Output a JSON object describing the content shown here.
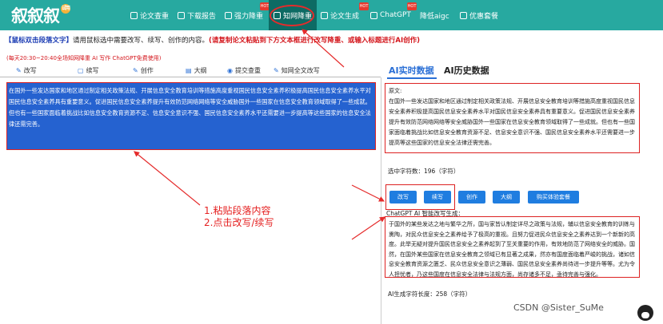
{
  "logo": {
    "text": "叙叙叙",
    "badge": "试用"
  },
  "nav": {
    "items": [
      "论文查重",
      "下载报告",
      "强力降重",
      "知网降重",
      "论文生成",
      "ChatGPT",
      "降低aigc",
      "优惠套餐"
    ],
    "hot_badges": [
      "HOT",
      "HOT",
      "HOT"
    ]
  },
  "instruction": {
    "prefix": "【鼠标双击段落文字】",
    "middle": "请用鼠标选中需要改写、续写、创作的内容。",
    "suffix": "(请复制论文粘贴到下方文本框进行改写降重、或输入标题进行AI创作)"
  },
  "notice": "(每天20:30~20:40全场知网降重 AI 写作 ChatGPT免费使用)",
  "toolbar": {
    "items": [
      "改写",
      "续写",
      "创作",
      "大纲",
      "提交查重",
      "知网全文改写"
    ],
    "icons": [
      "✎",
      "▢",
      "✎",
      "▤",
      "◉",
      "✎"
    ]
  },
  "selected_text": "在国外一些发达国家和地区通过制定相关政策法规、开展信息安全教育培训等措施高度重视国民信息安全素养积极提高国民信息安全素养水平对国民信息安全素养具有重要意义。促进国民信息安全素养提升有效防范网络网络等安全威胁国外一些国家在信息安全教育领域取得了一些成就。但也有一些国家面临着挑战比如信息安全教育资源不足、信息安全意识不强、国民信息安全素养水平还需要进一步提高等这些国家的信息安全法律还需完善。",
  "annotation": {
    "line1": "1.粘贴段落内容",
    "line2": "2.点击改写/续写"
  },
  "tabs": {
    "realtime": "AI实时数据",
    "history": "AI历史数据"
  },
  "original": {
    "label": "原文:",
    "text": "在国外一些发达国家和地区通过制定相关政策法规、开展信息安全教育培训等措施高度重视国民信息安全素养积极提高国民信息安全素养水平对国民信息安全素养具有重要意义。促进国民信息安全素养提升有效防范网络网络等安全威胁国外一些国家在信息安全教育领域取得了一些成就。但也有一些国家面临着挑战比如信息安全教育资源不足、信息安全意识不强、国民信息安全素养水平还需要进一步提高等这些国家的信息安全法律还需完善。"
  },
  "word_count": "选中字符数：196（字符）",
  "buttons": [
    "改写",
    "续写",
    "创作",
    "大纲",
    "购买体验套餐"
  ],
  "generated": {
    "label": "ChatGPT AI 智能改写生成：",
    "text": "于国外的某些发达之地与繁华之所，国与家皆认制定详尽之政策与法规，辅以信息安全教育的训练与熏陶，对民众信息安全之素养给予了极高的重视。且努力促进民众信息安全之素养达到一个新新的高度。此举无疑对提升国民信息安全之素养起到了至关重要的作用，有效地防范了网络安全的威胁。国然，在国外某些国家在信息安全教育之领域已有显著之成果，然亦有国度面临着严峻的挑战，诸如信息安全教育资源之匮乏、民众信息安全意识之薄弱、国民信息安全素养尚待进一步提升等等。尤为令人担忧者，乃这些国度在信息安全法律与法规方面，尚存诸多不足，亟待完善与强化。"
  },
  "length": "AI生成字符长度：258（字符）",
  "watermark": "CSDN @Sister_SuMe",
  "colors": {
    "topbar": "#27a9a0",
    "active_nav": "#0d6b64",
    "accent_blue": "#2a6fd6",
    "highlight": "#d22222"
  }
}
